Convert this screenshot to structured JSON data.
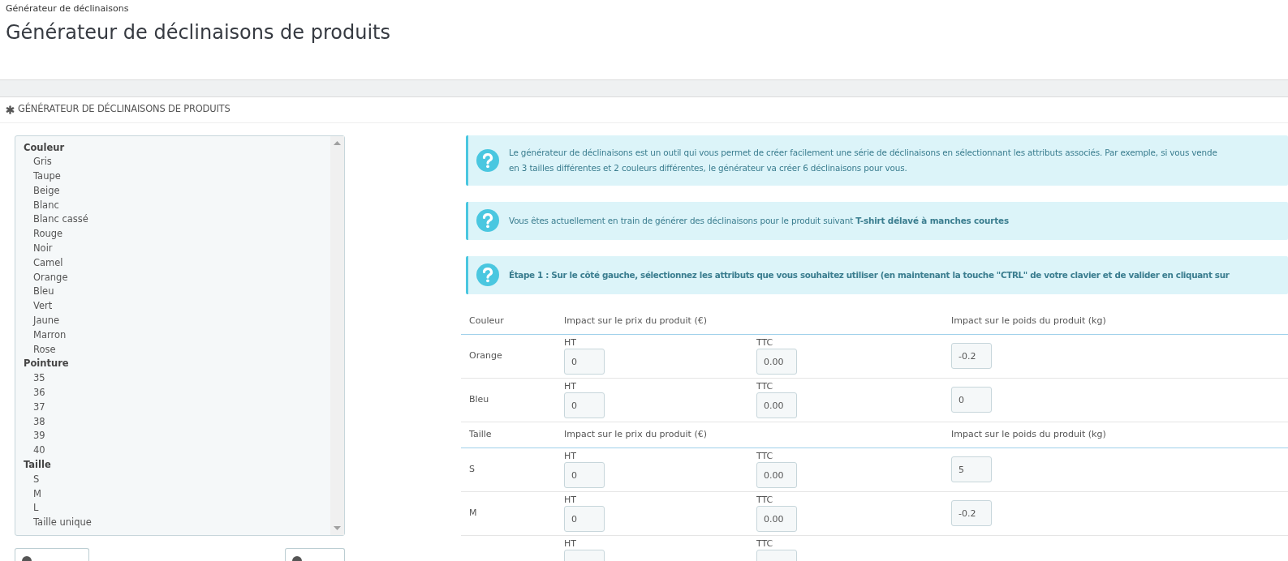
{
  "breadcrumb": "Générateur de déclinaisons",
  "page_title": "Générateur de déclinaisons de produits",
  "panel_heading": "GÉNÉRATEUR DE DÉCLINAISONS DE PRODUITS",
  "attribute_list": [
    {
      "group": "Couleur",
      "options": [
        "Gris",
        "Taupe",
        "Beige",
        "Blanc",
        "Blanc cassé",
        "Rouge",
        "Noir",
        "Camel",
        "Orange",
        "Bleu",
        "Vert",
        "Jaune",
        "Marron",
        "Rose"
      ]
    },
    {
      "group": "Pointure",
      "options": [
        "35",
        "36",
        "37",
        "38",
        "39",
        "40"
      ]
    },
    {
      "group": "Taille",
      "options": [
        "S",
        "M",
        "L",
        "Taille unique"
      ]
    }
  ],
  "alerts": [
    {
      "kind": "lines",
      "lines": [
        "Le générateur de déclinaisons est un outil qui vous permet de créer facilement une série de déclinaisons en sélectionnant les attributs associés. Par exemple, si vous vende",
        "en 3 tailles différentes et 2 couleurs différentes, le générateur va créer 6 déclinaisons pour vous."
      ]
    },
    {
      "kind": "rich",
      "text": "Vous êtes actuellement en train de générer des déclinaisons pour le produit suivant **T-shirt délavé à manches courtes**"
    },
    {
      "kind": "bold",
      "text": "Étape 1 : Sur le côté gauche, sélectionnez les attributs que vous souhaitez utiliser (en maintenant la touche \"CTRL\" de votre clavier et de valider en cliquant sur"
    }
  ],
  "impact_groups": [
    {
      "columns": [
        "Couleur",
        "Impact sur le prix du produit (€)",
        "Impact sur le poids du produit (kg)"
      ],
      "rows": [
        {
          "label": "Orange",
          "ht_label": "HT",
          "ht": "0",
          "ttc_label": "TTC",
          "ttc": "0.00",
          "weight": "-0.2"
        },
        {
          "label": "Bleu",
          "ht_label": "HT",
          "ht": "0",
          "ttc_label": "TTC",
          "ttc": "0.00",
          "weight": "0"
        }
      ]
    },
    {
      "columns": [
        "Taille",
        "Impact sur le prix du produit (€)",
        "Impact sur le poids du produit (kg)"
      ],
      "rows": [
        {
          "label": "S",
          "ht_label": "HT",
          "ht": "0",
          "ttc_label": "TTC",
          "ttc": "0.00",
          "weight": "5"
        },
        {
          "label": "M",
          "ht_label": "HT",
          "ht": "0",
          "ttc_label": "TTC",
          "ttc": "0.00",
          "weight": "-0.2"
        },
        {
          "ht_label": "HT",
          "ttc_label": "TTC"
        }
      ]
    }
  ]
}
